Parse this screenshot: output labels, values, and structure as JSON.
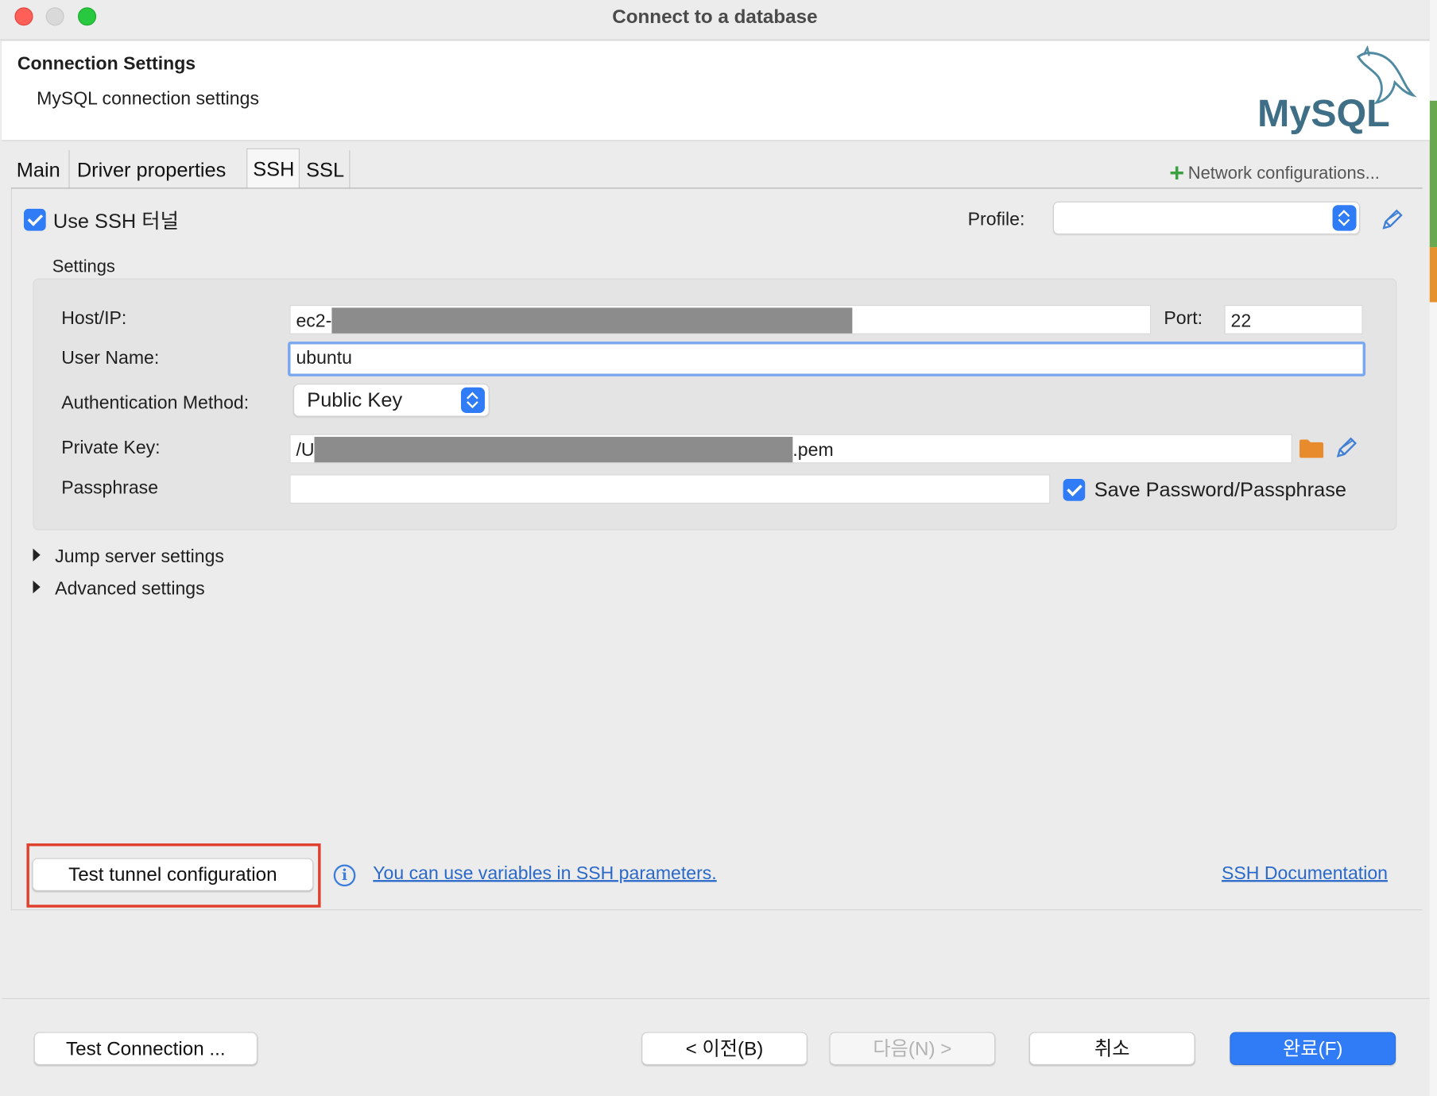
{
  "window": {
    "title": "Connect to a database"
  },
  "header": {
    "title": "Connection Settings",
    "subtitle": "MySQL connection settings",
    "logo_text": "MySQL"
  },
  "tabs": [
    {
      "label": "Main",
      "active": false
    },
    {
      "label": "Driver properties",
      "active": false
    },
    {
      "label": "SSH",
      "active": true
    },
    {
      "label": "SSL",
      "active": false
    }
  ],
  "network_configurations": "Network configurations...",
  "use_ssh": {
    "label": "Use SSH 터널",
    "checked": true
  },
  "profile": {
    "label": "Profile:",
    "value": ""
  },
  "settings": {
    "title": "Settings",
    "host_label": "Host/IP:",
    "host_value_prefix": "ec2-",
    "port_label": "Port:",
    "port_value": "22",
    "user_label": "User Name:",
    "user_value": "ubuntu",
    "auth_label": "Authentication Method:",
    "auth_value": "Public Key",
    "key_label": "Private Key:",
    "key_value_prefix": "/U",
    "key_value_suffix": ".pem",
    "pass_label": "Passphrase",
    "pass_value": "",
    "save_pass_label": "Save Password/Passphrase",
    "save_pass_checked": true
  },
  "expanders": [
    {
      "label": "Jump server settings"
    },
    {
      "label": "Advanced settings"
    }
  ],
  "tunnel": {
    "test_button": "Test tunnel configuration",
    "variables_link": "You can use variables in SSH parameters.",
    "docs_link": "SSH Documentation"
  },
  "footer": {
    "test_connection": "Test Connection ...",
    "back": "< 이전(B)",
    "next": "다음(N) >",
    "cancel": "취소",
    "finish": "완료(F)"
  },
  "colors": {
    "accent": "#2f7cf6",
    "highlight_border": "#e0402e",
    "link": "#2a69c9"
  }
}
